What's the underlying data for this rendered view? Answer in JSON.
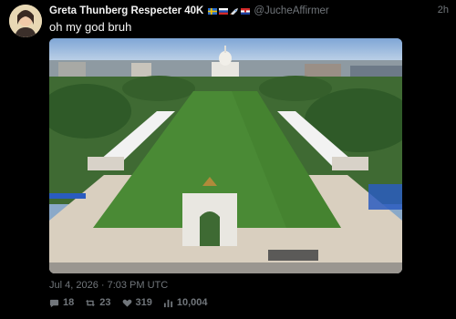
{
  "tweet": {
    "author_name": "Greta Thunberg Respecter 40K",
    "author_flags": [
      "flag-sweden-icon",
      "flag-slovenia-icon",
      "rocket-icon",
      "flag-croatia-icon"
    ],
    "handle": "@JucheAffirmer",
    "relative_time": "2h",
    "text": "oh my god bruh",
    "image_alt_visible": "",
    "date": "Jul 4, 2026 · 7:03 PM UTC",
    "stats": {
      "replies": "18",
      "retweets": "23",
      "likes": "319",
      "views": "10,004"
    }
  },
  "icons": {
    "reply": "speech-bubble-icon",
    "retweet": "retweet-arrows-icon",
    "like": "heart-icon",
    "views": "bar-chart-icon"
  },
  "colors": {
    "background": "#000000",
    "muted_text": "#71767b",
    "primary_text": "#e7e9ea"
  }
}
